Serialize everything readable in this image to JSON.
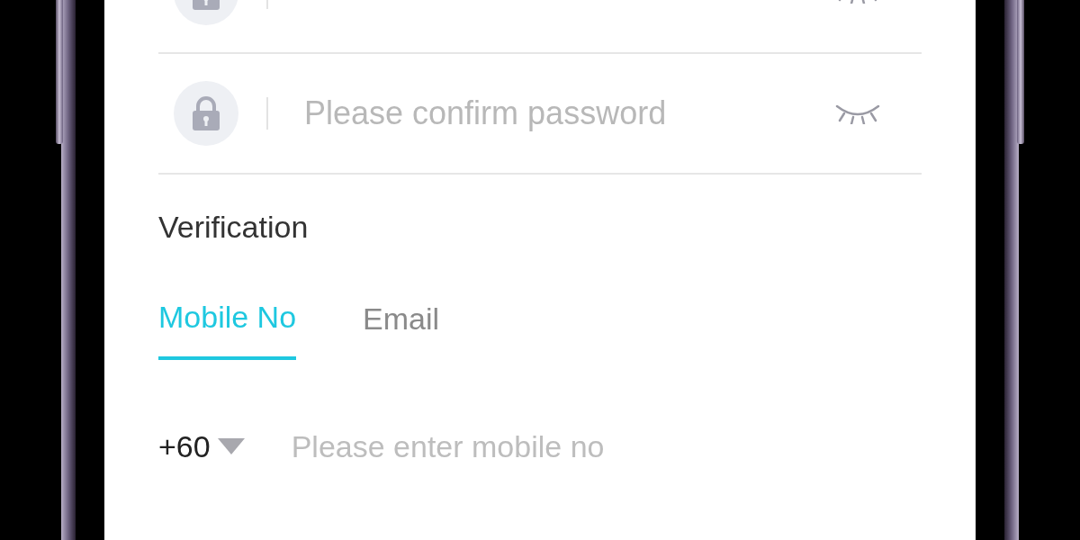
{
  "password_fields": [
    {
      "placeholder": "Please confirm password"
    }
  ],
  "verification": {
    "title": "Verification",
    "tabs": [
      {
        "label": "Mobile No",
        "selected": true
      },
      {
        "label": "Email",
        "selected": false
      }
    ],
    "mobile": {
      "country_code": "+60",
      "placeholder": "Please enter mobile no"
    }
  }
}
